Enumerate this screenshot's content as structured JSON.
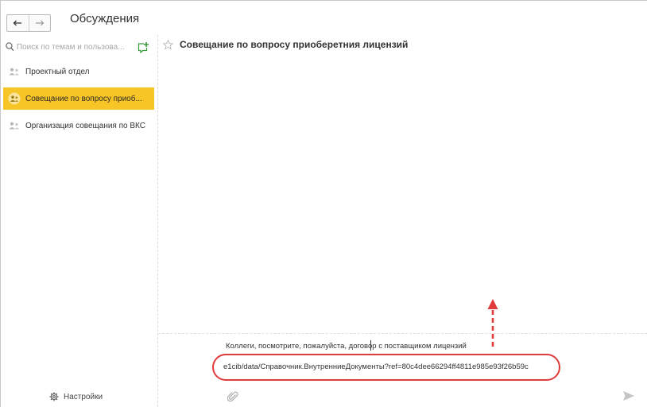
{
  "header": {
    "title": "Обсуждения",
    "back_icon": "arrow-left-icon",
    "forward_icon": "arrow-right-icon"
  },
  "sidebar": {
    "search": {
      "value": "",
      "placeholder": "Поиск по темам и пользова..."
    },
    "add_icon": "add-topic-icon",
    "topics": [
      {
        "label": "Проектный отдел",
        "active": false
      },
      {
        "label": "Совещание по вопросу приоб...",
        "active": true
      },
      {
        "label": "Организация совещания по ВКС",
        "active": false
      }
    ],
    "settings_label": "Настройки",
    "settings_icon": "gear-icon"
  },
  "conversation": {
    "title": "Совещание по вопросу приоберетния лицензий",
    "favorite_icon": "star-icon"
  },
  "compose": {
    "message": "Коллеги, посмотрите, пожалуйста, договор с поставщиком лицензий",
    "link": "e1cib/data/Справочник.ВнутренниеДокументы?ref=80c4dee66294ff4811e985e93f26b59c",
    "attach_icon": "paperclip-icon",
    "send_icon": "send-icon"
  },
  "colors": {
    "active_topic": "#f7c626",
    "annotation": "#e03a3a"
  }
}
